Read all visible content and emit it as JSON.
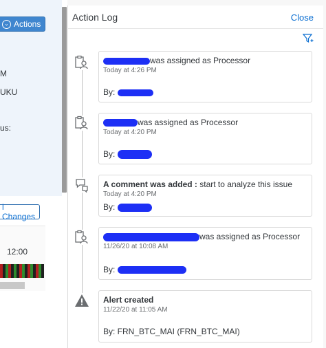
{
  "left": {
    "actions_label": "Actions",
    "frag_m": "M",
    "frag_uku": "UKU",
    "frag_us": "us:",
    "changes_label": "l Changes",
    "time_label": "12:00"
  },
  "panel": {
    "title": "Action Log",
    "close_label": "Close"
  },
  "entries": [
    {
      "icon": "user-assignment-icon",
      "text": "was assigned as Processor",
      "date": "Today at 4:26 PM",
      "by": "By:"
    },
    {
      "icon": "user-assignment-icon",
      "text": "was assigned as Processor",
      "date": "Today at 4:20 PM",
      "by": "By:"
    },
    {
      "icon": "comment-icon",
      "bold": "A comment was added :",
      "text": " start to analyze this issue",
      "date": "Today at 4:20 PM",
      "by": "By:"
    },
    {
      "icon": "user-assignment-icon",
      "text": "was assigned as Processor",
      "date": "11/26/20 at 10:08 AM",
      "by": "By:"
    },
    {
      "icon": "alert-icon",
      "bold": "Alert created",
      "date": "11/22/20 at 11:05 AM",
      "by": "By: FRN_BTC_MAI (FRN_BTC_MAI)"
    }
  ],
  "colors": {
    "accent": "#0a6ed1",
    "button": "#3f86cf",
    "redaction": "#1d2ff5"
  }
}
